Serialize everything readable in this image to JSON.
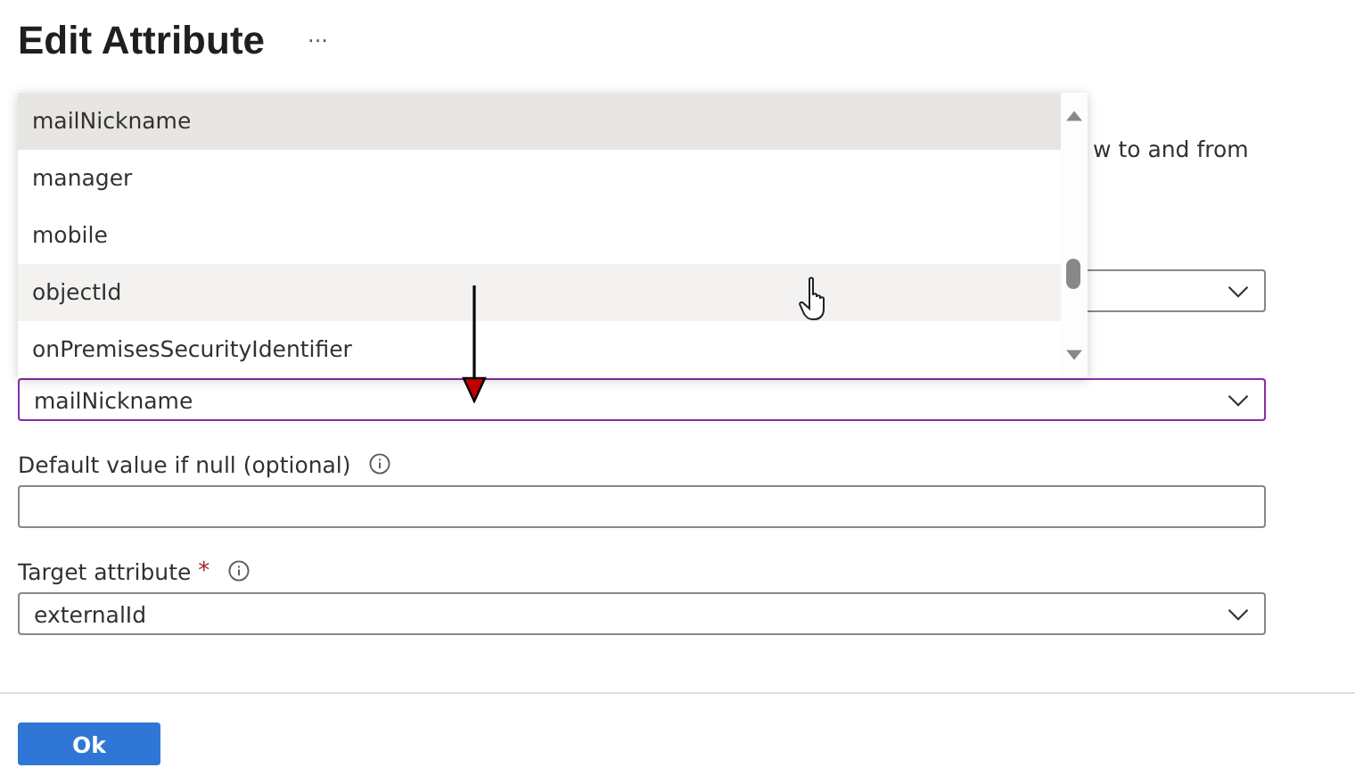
{
  "title": "Edit Attribute",
  "more": "···",
  "description_fragment": "w to and from",
  "source_field": {
    "value": "mailNickname",
    "focused": true
  },
  "default_field": {
    "label": "Default value if null (optional)"
  },
  "target_field": {
    "label": "Target attribute",
    "required": true,
    "required_mark": "*",
    "value": "externalId"
  },
  "dropdown_list": [
    {
      "label": "mailNickname",
      "selected": true,
      "hovered": false
    },
    {
      "label": "manager",
      "selected": false,
      "hovered": false
    },
    {
      "label": "mobile",
      "selected": false,
      "hovered": false
    },
    {
      "label": "objectId",
      "selected": false,
      "hovered": true
    },
    {
      "label": "onPremisesSecurityIdentifier",
      "selected": false,
      "hovered": false
    }
  ],
  "ok_button": "Ok"
}
